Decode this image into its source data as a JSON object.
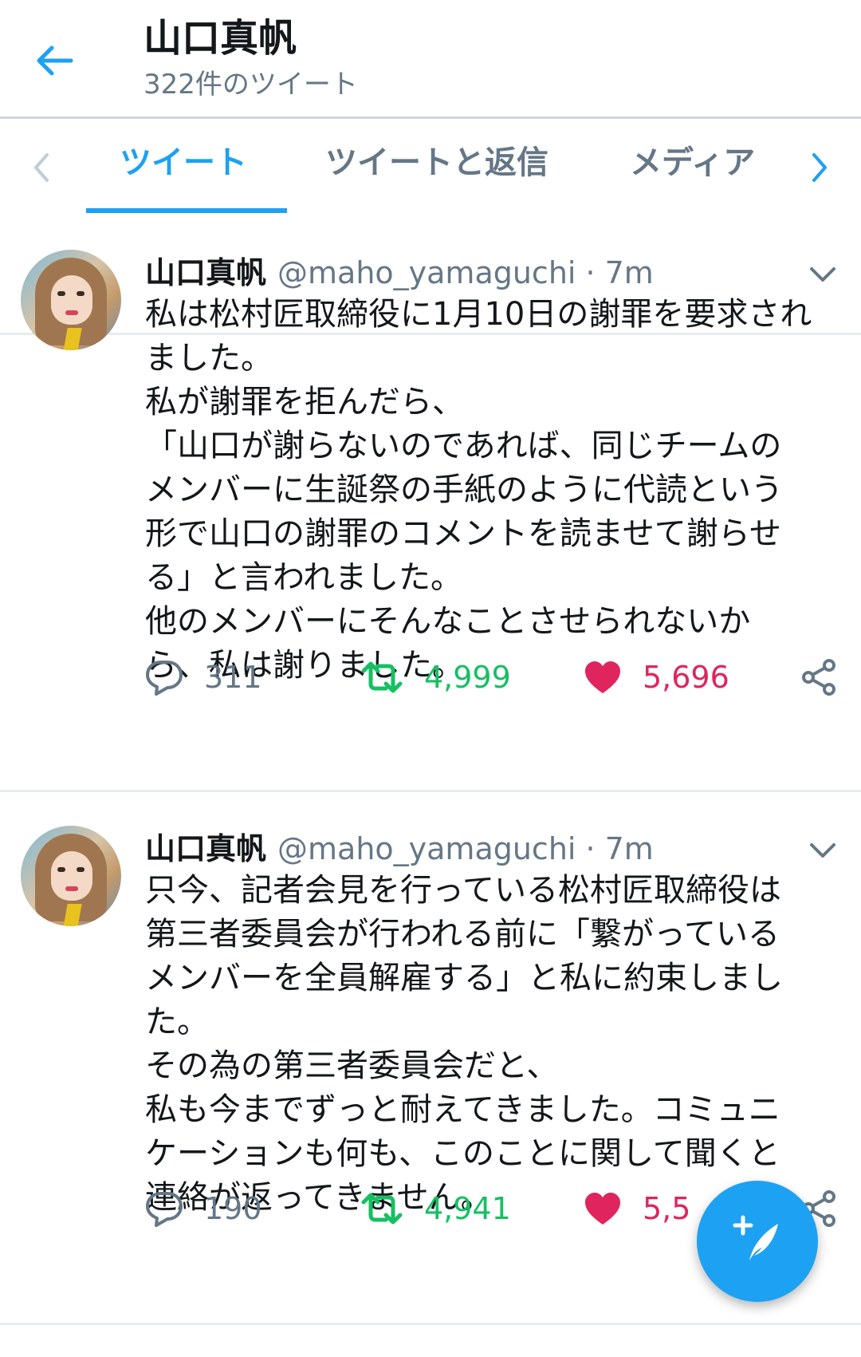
{
  "header": {
    "title": "山口真帆",
    "subtitle": "322件のツイート"
  },
  "tabs": [
    {
      "label": "ツイート",
      "active": true
    },
    {
      "label": "ツイートと返信",
      "active": false
    },
    {
      "label": "メディア",
      "active": false
    }
  ],
  "tweets": [
    {
      "display_name": "山口真帆",
      "handle": "@maho_yamaguchi",
      "separator": "·",
      "time": "7m",
      "lines": [
        "私は松村匠取締役に1月10日の謝罪を要求され",
        "ました。",
        "私が謝罪を拒んだら、",
        "「山口が謝らないのであれば、同じチームの",
        "メンバーに生誕祭の手紙のように代読という",
        "形で山口の謝罪のコメントを読ませて謝らせ",
        "る」と言われました。",
        "他のメンバーにそんなことさせられないか",
        "ら、私は謝りました。"
      ],
      "replies": "311",
      "retweets": "4,999",
      "likes": "5,696"
    },
    {
      "display_name": "山口真帆",
      "handle": "@maho_yamaguchi",
      "separator": "·",
      "time": "7m",
      "lines": [
        "只今、記者会見を行っている松村匠取締役は",
        "第三者委員会が行われる前に「繋がっている",
        "メンバーを全員解雇する」と私に約束しまし",
        "た。",
        "その為の第三者委員会だと、",
        "私も今までずっと耐えてきました。コミュニ",
        "ケーションも何も、このことに関して聞くと",
        "連絡が返ってきません。"
      ],
      "replies": "190",
      "retweets": "4,941",
      "likes": "5,5"
    }
  ],
  "icons": {
    "back": "arrow-left-icon",
    "tab_prev": "chevron-left-icon",
    "tab_next": "chevron-right-icon",
    "caret": "chevron-down-icon",
    "reply": "reply-icon",
    "retweet": "retweet-icon",
    "like": "heart-icon",
    "share": "share-icon",
    "compose": "compose-tweet-icon"
  },
  "colors": {
    "accent": "#1da1f2",
    "retweet": "#17bf63",
    "like": "#e0245e",
    "secondary_text": "#657786"
  }
}
